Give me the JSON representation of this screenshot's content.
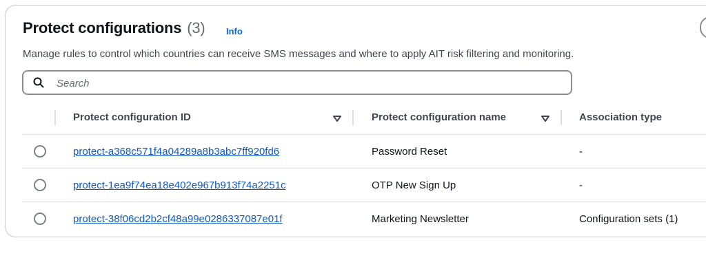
{
  "header": {
    "title": "Protect configurations",
    "count": "(3)",
    "info": "Info",
    "description": "Manage rules to control which countries can receive SMS messages and where to apply AIT risk filtering and monitoring."
  },
  "search": {
    "placeholder": "Search",
    "value": ""
  },
  "table": {
    "columns": [
      {
        "label": "Protect configuration ID"
      },
      {
        "label": "Protect configuration name"
      },
      {
        "label": "Association type"
      }
    ],
    "rows": [
      {
        "id": "protect-a368c571f4a04289a8b3abc7ff920fd6",
        "name": "Password Reset",
        "association": "-"
      },
      {
        "id": "protect-1ea9f74ea18e402e967b913f74a2251c",
        "name": "OTP New Sign Up",
        "association": "-"
      },
      {
        "id": "protect-38f06cd2b2cf48a99e0286337087e01f",
        "name": "Marketing Newsletter",
        "association": "Configuration sets (1)"
      }
    ]
  },
  "colors": {
    "link": "#0f58c6",
    "info": "#006ce0",
    "border": "#c6c6cd"
  }
}
